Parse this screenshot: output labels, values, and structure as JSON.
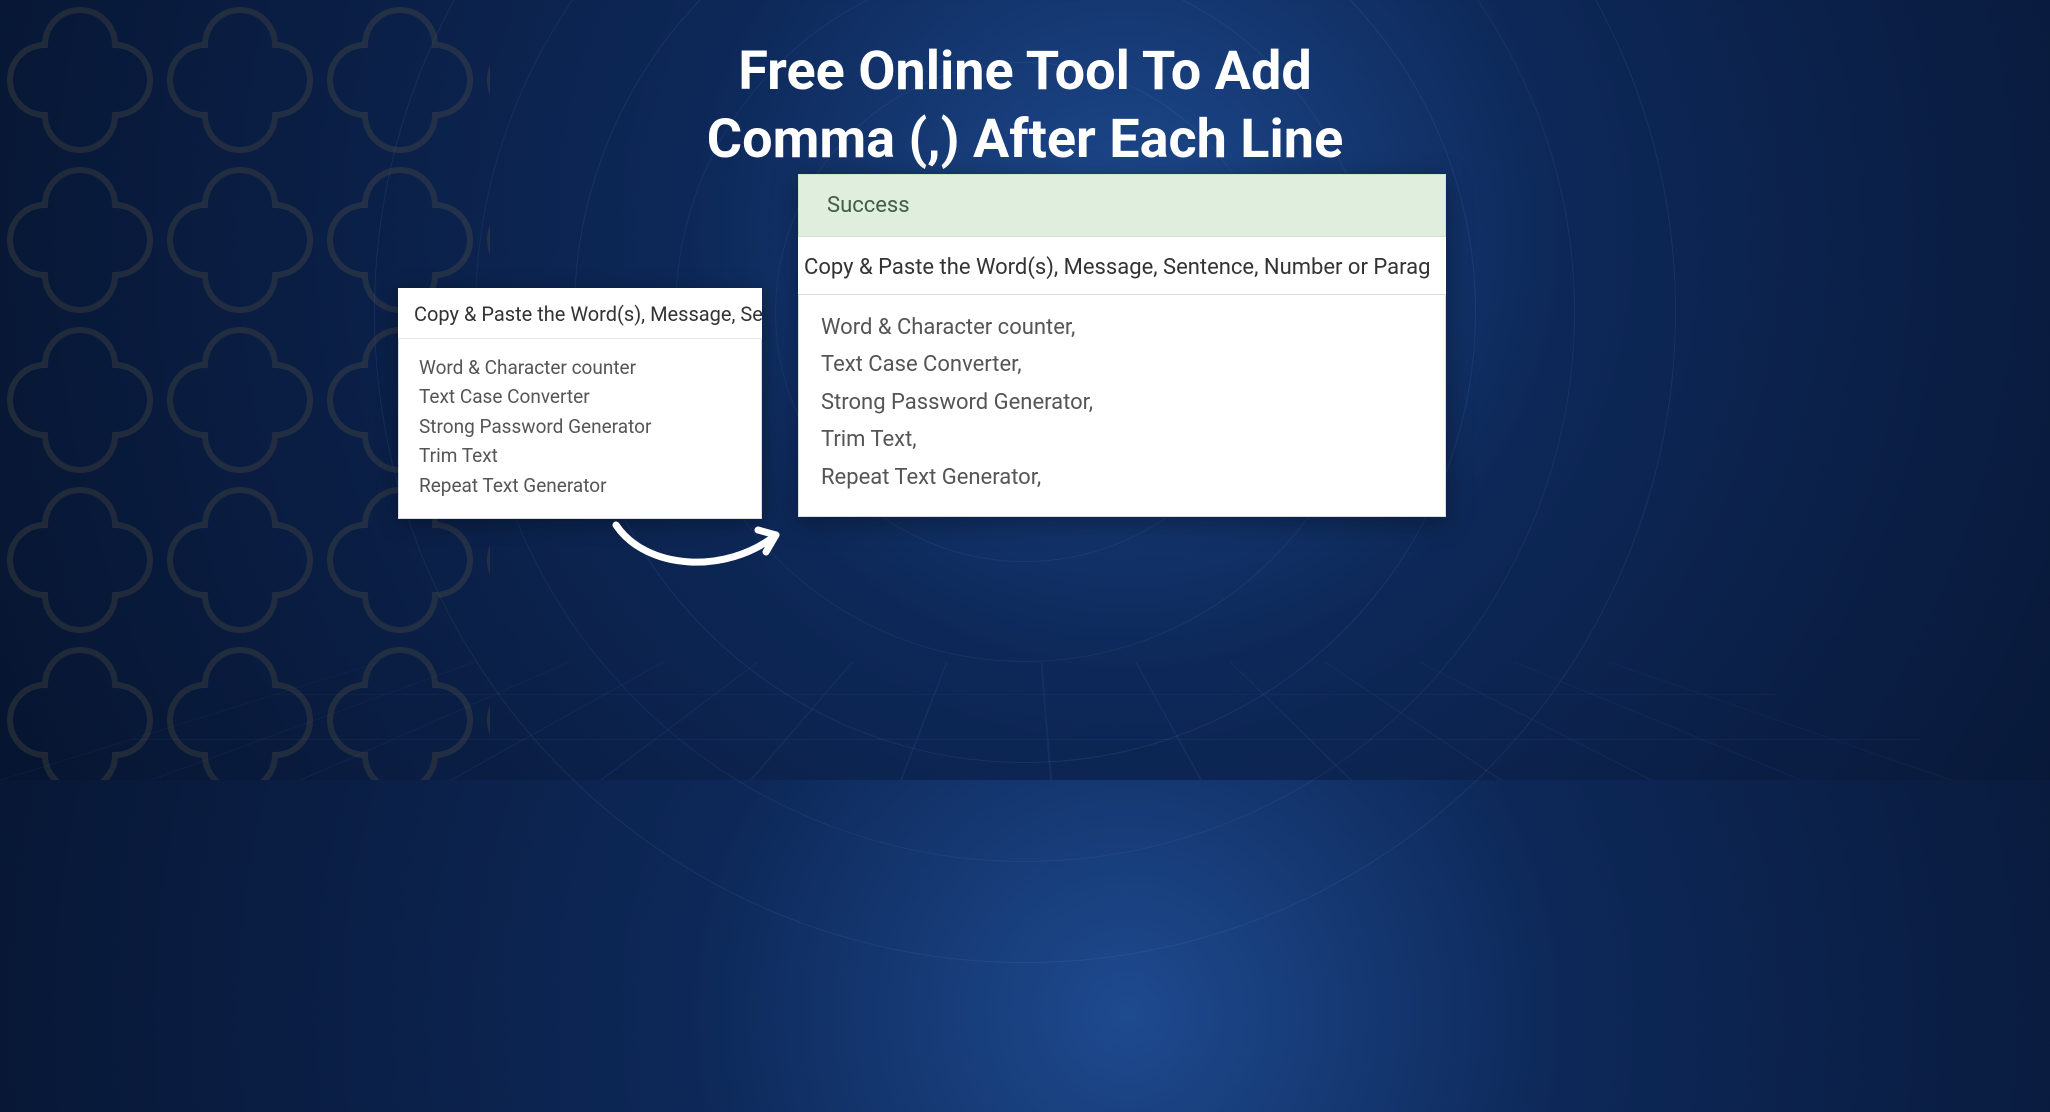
{
  "title_line1": "Free Online Tool To Add",
  "title_line2": "Comma (,) After Each Line",
  "before": {
    "instruction": "Copy & Paste the Word(s), Message, Se",
    "lines": [
      "Word & Character counter",
      "Text Case Converter",
      "Strong Password Generator",
      "Trim Text",
      "Repeat Text Generator"
    ]
  },
  "after": {
    "success_label": "Success",
    "instruction": "Copy & Paste the Word(s), Message, Sentence, Number or Parag",
    "lines": [
      "Word & Character counter,",
      "Text Case Converter,",
      "Strong Password Generator,",
      "Trim Text,",
      "Repeat Text Generator,"
    ]
  }
}
